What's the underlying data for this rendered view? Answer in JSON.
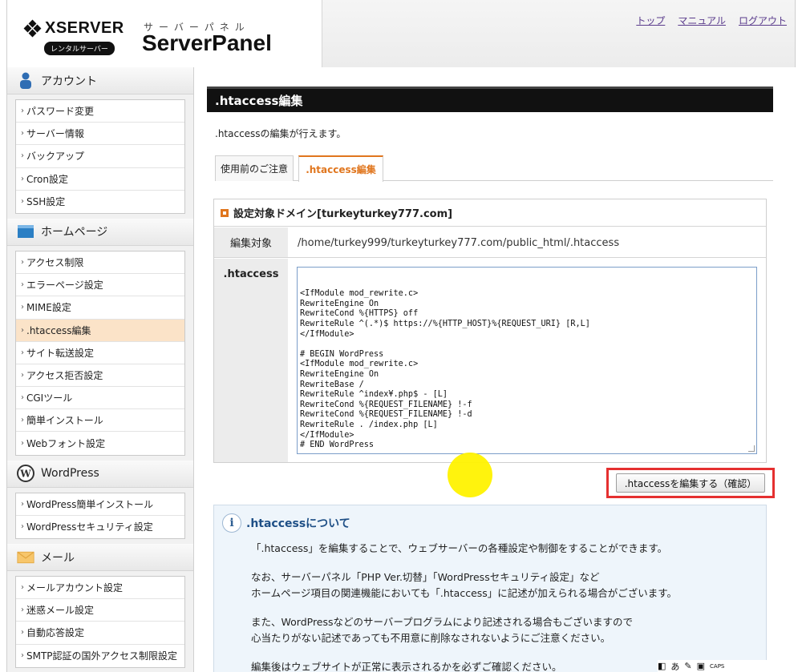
{
  "header": {
    "brand": "XSERVER",
    "badge": "レンタルサーバー",
    "kana": "サーバーパネル",
    "product": "ServerPanel",
    "links": [
      "トップ",
      "マニュアル",
      "ログアウト"
    ]
  },
  "sidebar": {
    "account": {
      "title": "アカウント",
      "items": [
        "パスワード変更",
        "サーバー情報",
        "バックアップ",
        "Cron設定",
        "SSH設定"
      ]
    },
    "homepage": {
      "title": "ホームページ",
      "items": [
        "アクセス制限",
        "エラーページ設定",
        "MIME設定",
        ".htaccess編集",
        "サイト転送設定",
        "アクセス拒否設定",
        "CGIツール",
        "簡単インストール",
        "Webフォント設定"
      ]
    },
    "wordpress": {
      "title": "WordPress",
      "items": [
        "WordPress簡単インストール",
        "WordPressセキュリティ設定"
      ]
    },
    "mail": {
      "title": "メール",
      "items": [
        "メールアカウント設定",
        "迷惑メール設定",
        "自動応答設定",
        "SMTP認証の国外アクセス制限設定"
      ]
    }
  },
  "main": {
    "title": ".htaccess編集",
    "description": ".htaccessの編集が行えます。",
    "tabs": [
      "使用前のご注意",
      ".htaccess編集"
    ],
    "panel_title": "設定対象ドメイン[turkeyturkey777.com]",
    "target_label": "編集対象",
    "target_path": "/home/turkey999/turkeyturkey777.com/public_html/.htaccess",
    "htaccess_label": ".htaccess",
    "confirm_button": ".htaccessを編集する（確認）"
  },
  "editor_lines": [
    "<IfModule mod_rewrite.c>",
    "RewriteEngine On",
    "RewriteCond %{HTTPS} off",
    "RewriteRule ^(.*)$ https://%{HTTP_HOST}%{REQUEST_URI} [R,L]",
    "</IfModule>",
    "",
    "# BEGIN WordPress",
    "<IfModule mod_rewrite.c>",
    "RewriteEngine On",
    "RewriteBase /",
    "RewriteRule ^index¥.php$ - [L]",
    "RewriteCond %{REQUEST_FILENAME} !-f",
    "RewriteCond %{REQUEST_FILENAME} !-d",
    "RewriteRule . /index.php [L]",
    "</IfModule>",
    "# END WordPress"
  ],
  "info": {
    "title": ".htaccessについて",
    "p1": "「.htaccess」を編集することで、ウェブサーバーの各種設定や制御をすることができます。",
    "p2a": "なお、サーバーパネル「PHP Ver.切替」「WordPressセキュリティ設定」など",
    "p2b": "ホームページ項目の関連機能においても「.htaccess」に記述が加えられる場合がございます。",
    "p3a": "また、WordPressなどのサーバープログラムにより記述される場合もございますので",
    "p3b": "心当たりがない記述であっても不用意に削除なされないようにご注意ください。",
    "p4": "編集後はウェブサイトが正常に表示されるかを必ずご確認ください。"
  },
  "tray": {
    "text": "あ",
    "caps": "CAPS"
  },
  "colors": {
    "accent": "#e0761e",
    "title_bg": "#111111",
    "highlight": "#e53030",
    "cursor": "#fff200"
  }
}
